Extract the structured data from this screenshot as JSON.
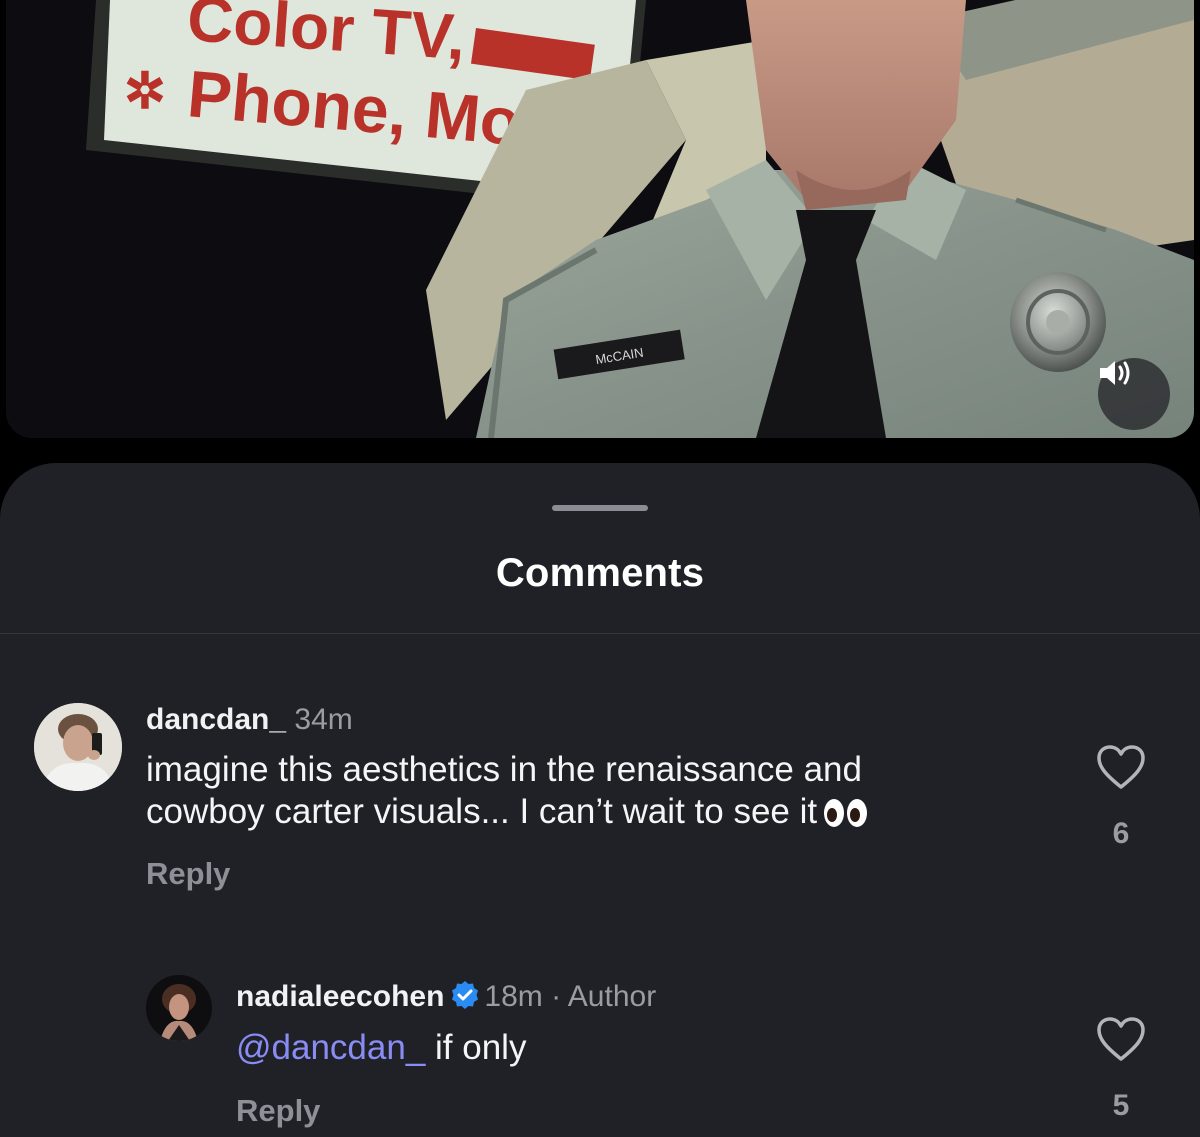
{
  "video": {
    "sign_line_1": "Color TV,",
    "sign_line_2": "Phone, Movie",
    "name_tag": "McCAIN",
    "mute_icon": "speaker-volume-icon"
  },
  "sheet": {
    "title": "Comments"
  },
  "comments": [
    {
      "username": "dancdan_",
      "time": "34m",
      "text_line_1": "imagine this aesthetics in the renaissance and",
      "text_line_2": "cowboy carter visuals... I can’t wait to see it",
      "emoji": "👀",
      "reply_label": "Reply",
      "likes": "6"
    },
    {
      "username": "nadialeecohen",
      "verified": true,
      "time": "18m",
      "separator": "·",
      "author_tag": "Author",
      "mention": "@dancdan_",
      "text": " if only",
      "reply_label": "Reply",
      "likes": "5"
    }
  ],
  "colors": {
    "sheet_bg": "#202126",
    "mention": "#8a8cf5",
    "verified": "#2a8bf2",
    "muted_text": "#9a9ca3"
  }
}
